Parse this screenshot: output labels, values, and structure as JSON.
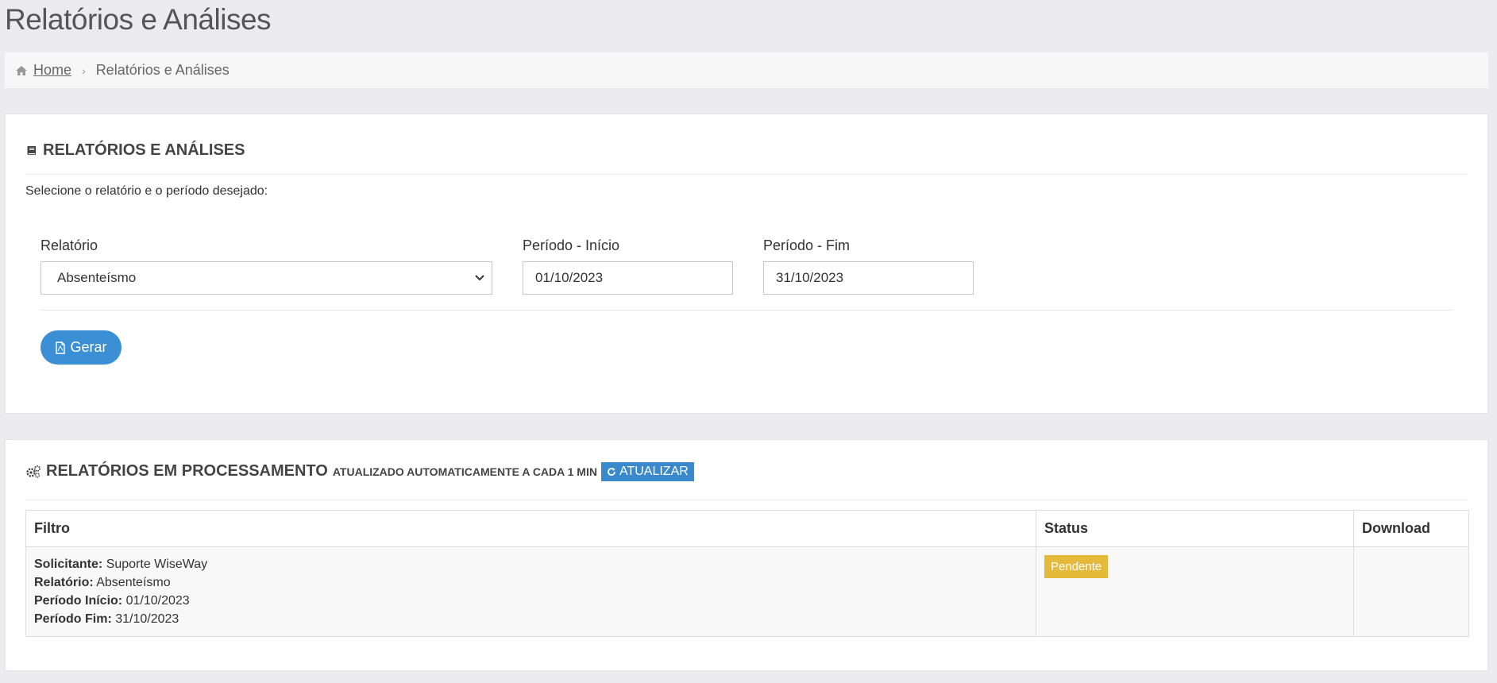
{
  "page": {
    "title": "Relatórios e Análises"
  },
  "breadcrumb": {
    "home_label": "Home",
    "current_label": "Relatórios e Análises"
  },
  "report_panel": {
    "heading": "RELATÓRIOS E ANÁLISES",
    "intro": "Selecione o relatório e o período desejado:",
    "fields": {
      "report": {
        "label": "Relatório",
        "value": "Absenteísmo"
      },
      "start": {
        "label": "Período - Início",
        "value": "01/10/2023"
      },
      "end": {
        "label": "Período - Fim",
        "value": "31/10/2023"
      }
    },
    "generate_label": "Gerar"
  },
  "processing_panel": {
    "heading": "RELATÓRIOS EM PROCESSAMENTO",
    "auto_update": "ATUALIZADO AUTOMATICAMENTE A CADA 1 MIN",
    "refresh_label": "ATUALIZAR",
    "columns": [
      "Filtro",
      "Status",
      "Download"
    ],
    "rows": [
      {
        "requester_label": "Solicitante:",
        "requester": "Suporte WiseWay",
        "report_label": "Relatório:",
        "report": "Absenteísmo",
        "start_label": "Período Início:",
        "start": "01/10/2023",
        "end_label": "Período Fim:",
        "end": "31/10/2023",
        "status": "Pendente",
        "download": ""
      }
    ]
  },
  "colors": {
    "primary": "#3a8fd5",
    "pending": "#e5b93a",
    "background": "#ebebf0"
  }
}
